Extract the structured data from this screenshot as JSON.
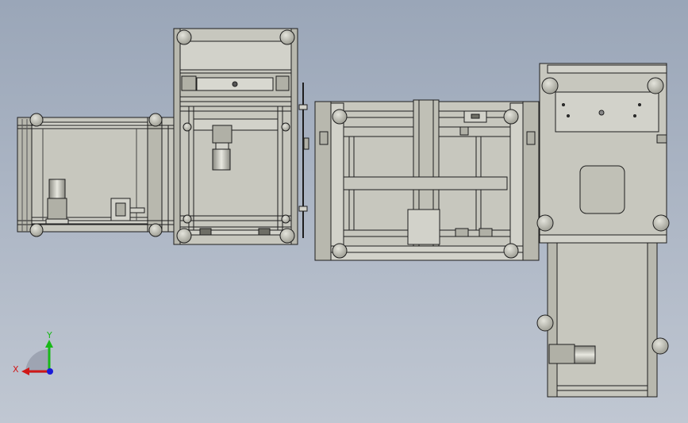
{
  "view": {
    "background_top": "#9aa6b8",
    "background_bottom": "#c0c7d2",
    "model_fill": "#c7c7be",
    "edge_color": "#1e1e1e",
    "dark_part": "#6e6e66"
  },
  "triad": {
    "x_label": "X",
    "y_label": "Y",
    "x_color": "#d01818",
    "y_color": "#18b818",
    "z_color": "#1a1ad8"
  }
}
